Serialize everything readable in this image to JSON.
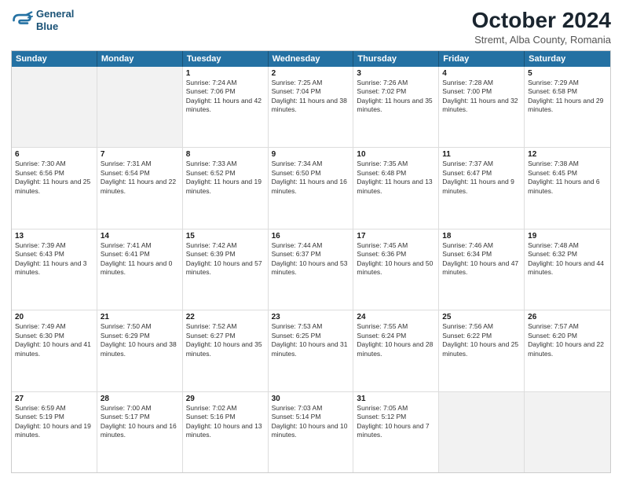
{
  "logo": {
    "line1": "General",
    "line2": "Blue"
  },
  "title": "October 2024",
  "subtitle": "Stremt, Alba County, Romania",
  "header_days": [
    "Sunday",
    "Monday",
    "Tuesday",
    "Wednesday",
    "Thursday",
    "Friday",
    "Saturday"
  ],
  "rows": [
    [
      {
        "day": "",
        "text": ""
      },
      {
        "day": "",
        "text": ""
      },
      {
        "day": "1",
        "text": "Sunrise: 7:24 AM\nSunset: 7:06 PM\nDaylight: 11 hours and 42 minutes."
      },
      {
        "day": "2",
        "text": "Sunrise: 7:25 AM\nSunset: 7:04 PM\nDaylight: 11 hours and 38 minutes."
      },
      {
        "day": "3",
        "text": "Sunrise: 7:26 AM\nSunset: 7:02 PM\nDaylight: 11 hours and 35 minutes."
      },
      {
        "day": "4",
        "text": "Sunrise: 7:28 AM\nSunset: 7:00 PM\nDaylight: 11 hours and 32 minutes."
      },
      {
        "day": "5",
        "text": "Sunrise: 7:29 AM\nSunset: 6:58 PM\nDaylight: 11 hours and 29 minutes."
      }
    ],
    [
      {
        "day": "6",
        "text": "Sunrise: 7:30 AM\nSunset: 6:56 PM\nDaylight: 11 hours and 25 minutes."
      },
      {
        "day": "7",
        "text": "Sunrise: 7:31 AM\nSunset: 6:54 PM\nDaylight: 11 hours and 22 minutes."
      },
      {
        "day": "8",
        "text": "Sunrise: 7:33 AM\nSunset: 6:52 PM\nDaylight: 11 hours and 19 minutes."
      },
      {
        "day": "9",
        "text": "Sunrise: 7:34 AM\nSunset: 6:50 PM\nDaylight: 11 hours and 16 minutes."
      },
      {
        "day": "10",
        "text": "Sunrise: 7:35 AM\nSunset: 6:48 PM\nDaylight: 11 hours and 13 minutes."
      },
      {
        "day": "11",
        "text": "Sunrise: 7:37 AM\nSunset: 6:47 PM\nDaylight: 11 hours and 9 minutes."
      },
      {
        "day": "12",
        "text": "Sunrise: 7:38 AM\nSunset: 6:45 PM\nDaylight: 11 hours and 6 minutes."
      }
    ],
    [
      {
        "day": "13",
        "text": "Sunrise: 7:39 AM\nSunset: 6:43 PM\nDaylight: 11 hours and 3 minutes."
      },
      {
        "day": "14",
        "text": "Sunrise: 7:41 AM\nSunset: 6:41 PM\nDaylight: 11 hours and 0 minutes."
      },
      {
        "day": "15",
        "text": "Sunrise: 7:42 AM\nSunset: 6:39 PM\nDaylight: 10 hours and 57 minutes."
      },
      {
        "day": "16",
        "text": "Sunrise: 7:44 AM\nSunset: 6:37 PM\nDaylight: 10 hours and 53 minutes."
      },
      {
        "day": "17",
        "text": "Sunrise: 7:45 AM\nSunset: 6:36 PM\nDaylight: 10 hours and 50 minutes."
      },
      {
        "day": "18",
        "text": "Sunrise: 7:46 AM\nSunset: 6:34 PM\nDaylight: 10 hours and 47 minutes."
      },
      {
        "day": "19",
        "text": "Sunrise: 7:48 AM\nSunset: 6:32 PM\nDaylight: 10 hours and 44 minutes."
      }
    ],
    [
      {
        "day": "20",
        "text": "Sunrise: 7:49 AM\nSunset: 6:30 PM\nDaylight: 10 hours and 41 minutes."
      },
      {
        "day": "21",
        "text": "Sunrise: 7:50 AM\nSunset: 6:29 PM\nDaylight: 10 hours and 38 minutes."
      },
      {
        "day": "22",
        "text": "Sunrise: 7:52 AM\nSunset: 6:27 PM\nDaylight: 10 hours and 35 minutes."
      },
      {
        "day": "23",
        "text": "Sunrise: 7:53 AM\nSunset: 6:25 PM\nDaylight: 10 hours and 31 minutes."
      },
      {
        "day": "24",
        "text": "Sunrise: 7:55 AM\nSunset: 6:24 PM\nDaylight: 10 hours and 28 minutes."
      },
      {
        "day": "25",
        "text": "Sunrise: 7:56 AM\nSunset: 6:22 PM\nDaylight: 10 hours and 25 minutes."
      },
      {
        "day": "26",
        "text": "Sunrise: 7:57 AM\nSunset: 6:20 PM\nDaylight: 10 hours and 22 minutes."
      }
    ],
    [
      {
        "day": "27",
        "text": "Sunrise: 6:59 AM\nSunset: 5:19 PM\nDaylight: 10 hours and 19 minutes."
      },
      {
        "day": "28",
        "text": "Sunrise: 7:00 AM\nSunset: 5:17 PM\nDaylight: 10 hours and 16 minutes."
      },
      {
        "day": "29",
        "text": "Sunrise: 7:02 AM\nSunset: 5:16 PM\nDaylight: 10 hours and 13 minutes."
      },
      {
        "day": "30",
        "text": "Sunrise: 7:03 AM\nSunset: 5:14 PM\nDaylight: 10 hours and 10 minutes."
      },
      {
        "day": "31",
        "text": "Sunrise: 7:05 AM\nSunset: 5:12 PM\nDaylight: 10 hours and 7 minutes."
      },
      {
        "day": "",
        "text": ""
      },
      {
        "day": "",
        "text": ""
      }
    ]
  ]
}
